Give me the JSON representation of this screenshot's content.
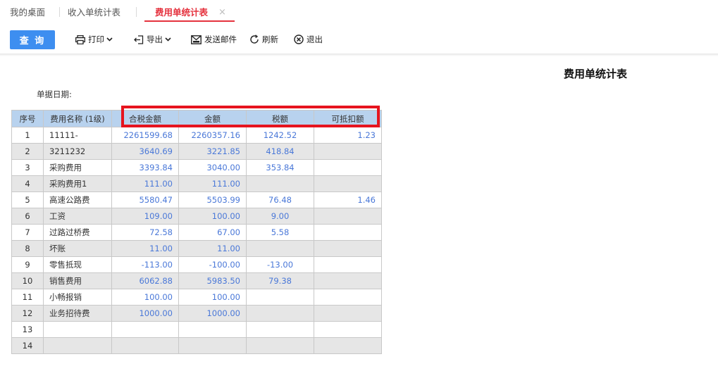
{
  "tabs": [
    {
      "label": "我的桌面"
    },
    {
      "label": "收入单统计表"
    },
    {
      "label": "费用单统计表",
      "active": true,
      "close": "×"
    }
  ],
  "toolbar": {
    "query_label": "查 询",
    "print_label": "打印",
    "export_label": "导出",
    "email_label": "发送邮件",
    "refresh_label": "刷新",
    "exit_label": "退出"
  },
  "report": {
    "title": "费用单统计表",
    "date_label": "单据日期:"
  },
  "table": {
    "headers": [
      "序号",
      "费用名称 (1级)",
      "合税金额",
      "金额",
      "税额",
      "可抵扣额"
    ],
    "rows": [
      [
        "1",
        "11111-",
        "2261599.68",
        "2260357.16",
        "1242.52",
        "1.23"
      ],
      [
        "2",
        "3211232",
        "3640.69",
        "3221.85",
        "418.84",
        ""
      ],
      [
        "3",
        "采购费用",
        "3393.84",
        "3040.00",
        "353.84",
        ""
      ],
      [
        "4",
        "采购费用1",
        "111.00",
        "111.00",
        "",
        ""
      ],
      [
        "5",
        "高速公路费",
        "5580.47",
        "5503.99",
        "76.48",
        "1.46"
      ],
      [
        "6",
        "工资",
        "109.00",
        "100.00",
        "9.00",
        ""
      ],
      [
        "7",
        "过路过桥费",
        "72.58",
        "67.00",
        "5.58",
        ""
      ],
      [
        "8",
        "坏账",
        "11.00",
        "11.00",
        "",
        ""
      ],
      [
        "9",
        "零售抵现",
        "-113.00",
        "-100.00",
        "-13.00",
        ""
      ],
      [
        "10",
        "销售费用",
        "6062.88",
        "5983.50",
        "79.38",
        ""
      ],
      [
        "11",
        "小畅报销",
        "100.00",
        "100.00",
        "",
        ""
      ],
      [
        "12",
        "业务招待费",
        "1000.00",
        "1000.00",
        "",
        ""
      ],
      [
        "13",
        "",
        "",
        "",
        "",
        ""
      ],
      [
        "14",
        "",
        "",
        "",
        "",
        ""
      ]
    ]
  },
  "colors": {
    "accent": "#3d8ef0",
    "active_tab": "#e5323e",
    "header_bg": "#b8d2ee",
    "number_text": "#4a78d8",
    "highlight": "#e6141e"
  },
  "icons": [
    "printer-icon",
    "export-icon",
    "email-icon",
    "refresh-icon",
    "exit-icon",
    "close-icon",
    "chevron-down-icon"
  ]
}
